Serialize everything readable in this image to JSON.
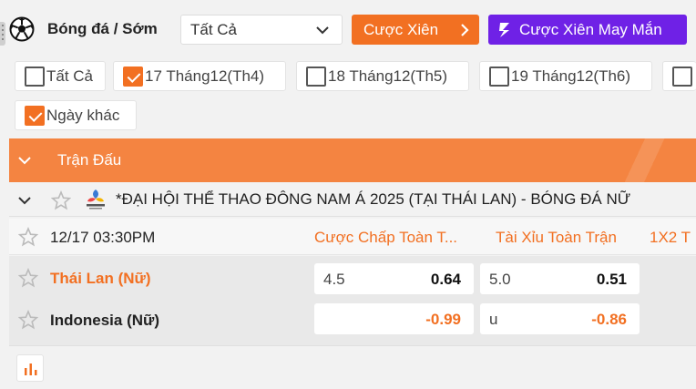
{
  "header": {
    "title": "Bóng đá / Sớm",
    "filter_select_value": "Tất Cả",
    "parlay_button": "Cược Xiên",
    "lucky_parlay_button": "Cược Xiên May Mắn"
  },
  "date_filters": [
    {
      "label": "Tất Cả",
      "checked": false
    },
    {
      "label": "17 Tháng12(Th4)",
      "checked": true
    },
    {
      "label": "18 Tháng12(Th5)",
      "checked": false
    },
    {
      "label": "19 Tháng12(Th6)",
      "checked": false
    },
    {
      "label": "",
      "checked": false
    },
    {
      "label": "Ngày khác",
      "checked": true
    }
  ],
  "section_header": "Trận Đấu",
  "league": {
    "name": "*ĐẠI HỘI THỂ THAO ĐÔNG NAM Á 2025 (TẠI THÁI LAN) - BÓNG ĐÁ NỮ",
    "logo_icon": "sea-games-thailand-2025-logo"
  },
  "match": {
    "time": "12/17 03:30PM",
    "columns": [
      "Cược Chấp Toàn T...",
      "Tài Xỉu Toàn Trận",
      "1X2 T"
    ],
    "home_team": "Thái Lan (Nữ)",
    "away_team": "Indonesia (Nữ)",
    "handicap": {
      "home_line": "4.5",
      "home_odds": "0.64",
      "away_line": "",
      "away_odds": "-0.99"
    },
    "over_under": {
      "over_line": "5.0",
      "over_odds": "0.51",
      "under_line": "u",
      "under_odds": "-0.86"
    }
  },
  "colors": {
    "accent": "#f27022",
    "purple": "#6f21e6",
    "header_bar": "#f48441"
  }
}
